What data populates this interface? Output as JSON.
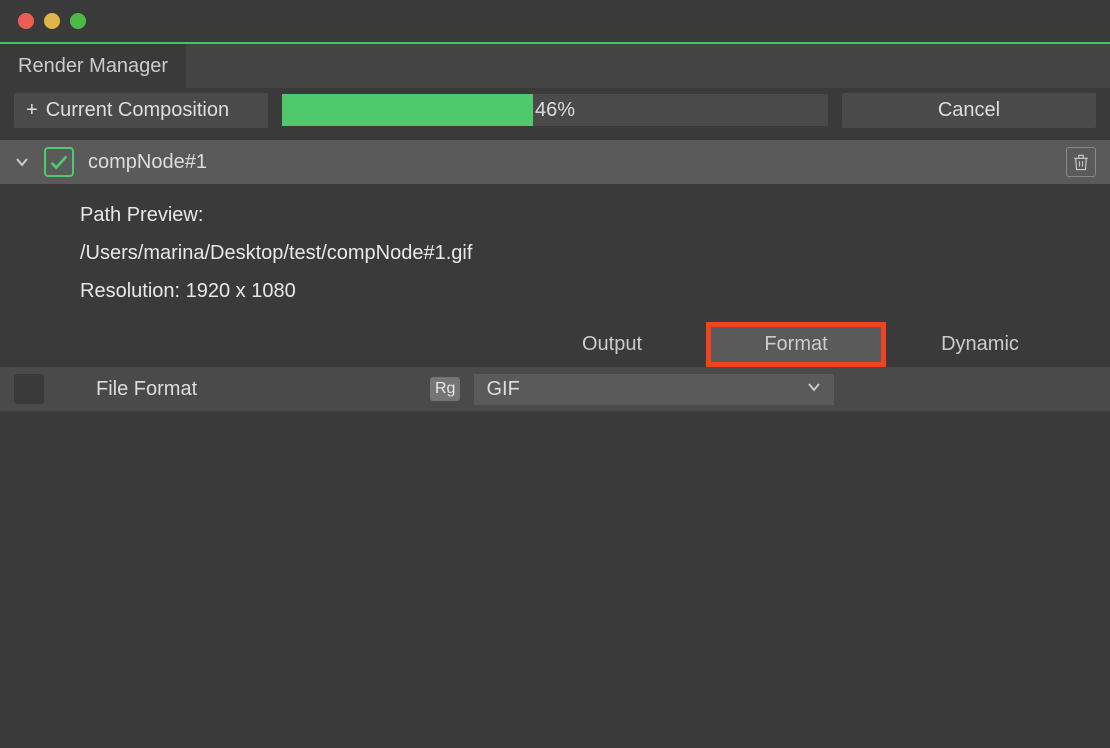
{
  "tabs": {
    "main": "Render Manager"
  },
  "toolbar": {
    "add_label": "Current Composition",
    "add_plus": "+",
    "progress_percent": 46,
    "progress_label": "46%",
    "cancel_label": "Cancel"
  },
  "node": {
    "title": "compNode#1",
    "checked": true,
    "path_preview_label": "Path Preview:",
    "path_preview_value": "/Users/marina/Desktop/test/compNode#1.gif",
    "resolution_label": "Resolution:",
    "resolution_value": "1920 x 1080"
  },
  "subtabs": {
    "output": "Output",
    "format": "Format",
    "dynamic": "Dynamic",
    "active": "format"
  },
  "format_section": {
    "file_format_label": "File Format",
    "rg_badge": "Rg",
    "dropdown_value": "GIF"
  }
}
